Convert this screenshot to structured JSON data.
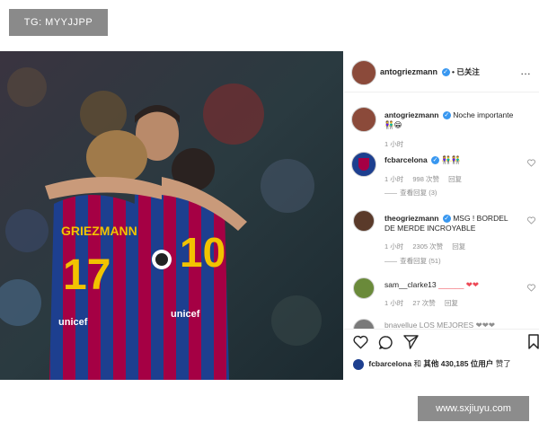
{
  "overlay": {
    "tag_text": "TG: MYYJJPP",
    "watermark_text": "www.sxjiuyu.com"
  },
  "post": {
    "author": "antogriezmann",
    "follow_label": "• 已关注",
    "more_icon": "more-dots-icon",
    "caption_user": "antogriezmann",
    "caption_text": "Noche importante",
    "caption_emoji": "👫😁",
    "caption_time": "1 小时"
  },
  "comments": [
    {
      "user": "fcbarcelona",
      "text": "👫👫",
      "time": "1 小时",
      "likes": "998 次赞",
      "reply": "回复",
      "view_replies": "查看回复 (3)"
    },
    {
      "user": "theogriezmann",
      "text": "MSG ! BORDEL DE MERDE INCROYABLE",
      "time": "1 小时",
      "likes": "2305 次赞",
      "reply": "回复",
      "view_replies": "查看回复 (51)"
    },
    {
      "user": "sam__clarke13",
      "text": "______ ❤❤",
      "time": "1 小时",
      "likes": "27 次赞",
      "reply": "回复"
    },
    {
      "user": "bnavellue",
      "text": "LOS MEJORES ❤❤❤"
    }
  ],
  "actions": {
    "like_icon": "heart-icon",
    "comment_icon": "comment-icon",
    "share_icon": "send-icon",
    "save_icon": "bookmark-icon"
  },
  "likes_line": {
    "user": "fcbarcelona",
    "and_label": "和",
    "others_label": "其他 430,185 位用户",
    "liked_label": "赞了"
  },
  "colors": {
    "verified": "#3897f0",
    "barca_blue": "#1d3f8f",
    "barca_red": "#a50044",
    "barca_yellow": "#f2c300",
    "heart_red": "#ed4956"
  }
}
